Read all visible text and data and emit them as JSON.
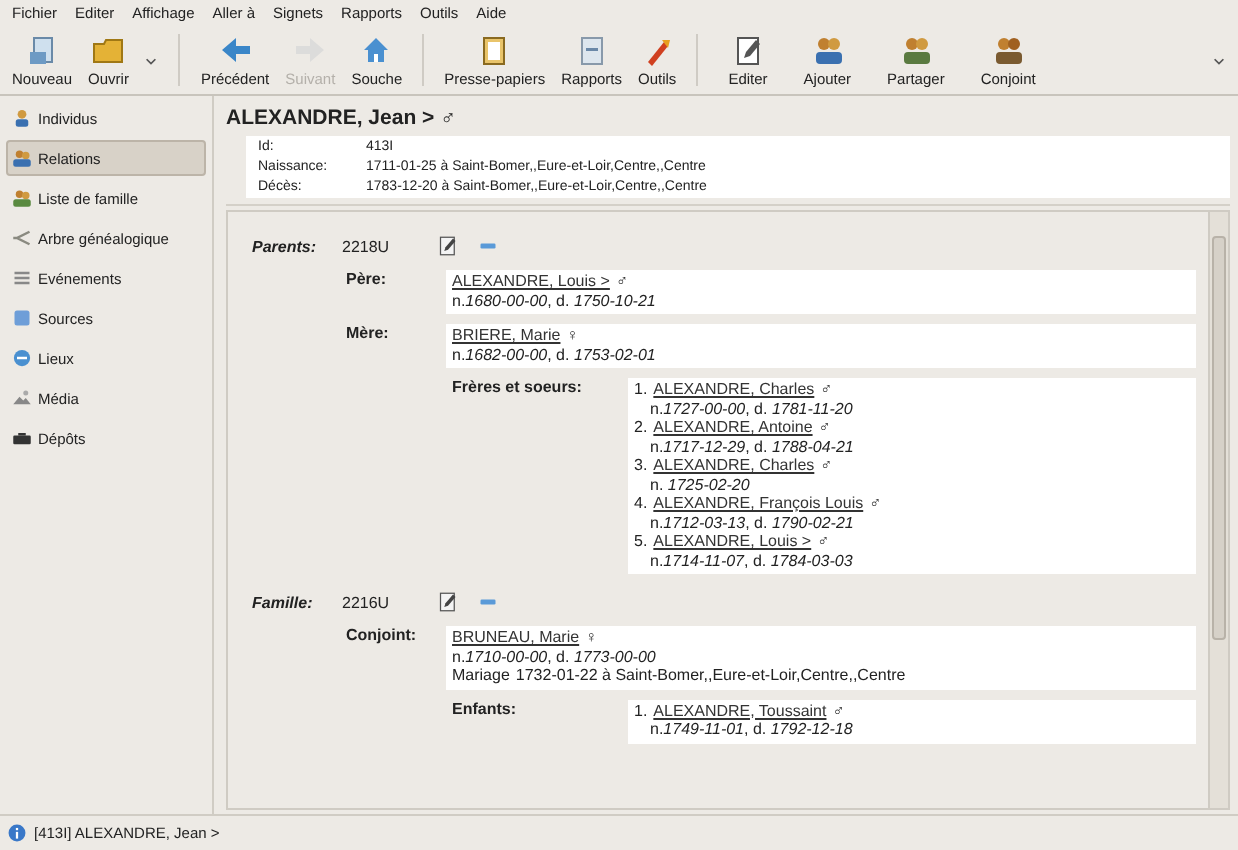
{
  "menu": [
    "Fichier",
    "Editer",
    "Affichage",
    "Aller à",
    "Signets",
    "Rapports",
    "Outils",
    "Aide"
  ],
  "toolbar": {
    "items": [
      {
        "kind": "button",
        "label": "Nouveau",
        "disabled": false
      },
      {
        "kind": "button",
        "label": "Ouvrir",
        "disabled": false
      },
      {
        "kind": "dropdown"
      },
      {
        "kind": "separator"
      },
      {
        "kind": "button",
        "label": "Précédent",
        "disabled": false
      },
      {
        "kind": "button",
        "label": "Suivant",
        "disabled": true
      },
      {
        "kind": "button",
        "label": "Souche",
        "disabled": false
      },
      {
        "kind": "separator"
      },
      {
        "kind": "button",
        "label": "Presse-papiers",
        "disabled": false
      },
      {
        "kind": "button",
        "label": "Rapports",
        "disabled": false
      },
      {
        "kind": "button",
        "label": "Outils",
        "disabled": false
      },
      {
        "kind": "separator"
      },
      {
        "kind": "button",
        "label": "Editer",
        "disabled": false
      },
      {
        "kind": "button",
        "label": "Ajouter",
        "disabled": false
      },
      {
        "kind": "button",
        "label": "Partager",
        "disabled": false
      },
      {
        "kind": "button",
        "label": "Conjoint",
        "disabled": false
      },
      {
        "kind": "dropdown"
      }
    ]
  },
  "sidebar": {
    "items": [
      {
        "label": "Individus",
        "selected": false
      },
      {
        "label": "Relations",
        "selected": true
      },
      {
        "label": "Liste de famille",
        "selected": false
      },
      {
        "label": "Arbre généalogique",
        "selected": false
      },
      {
        "label": "Evénements",
        "selected": false
      },
      {
        "label": "Sources",
        "selected": false
      },
      {
        "label": "Lieux",
        "selected": false
      },
      {
        "label": "Média",
        "selected": false
      },
      {
        "label": "Dépôts",
        "selected": false
      }
    ]
  },
  "person": {
    "name": "ALEXANDRE, Jean >",
    "sex": "♂",
    "facts": [
      {
        "label": "Id:",
        "value": "413I"
      },
      {
        "label": "Naissance:",
        "value": "1711-01-25 à Saint-Bomer,,Eure-et-Loir,Centre,,Centre"
      },
      {
        "label": "Décès:",
        "value": "1783-12-20 à Saint-Bomer,,Eure-et-Loir,Centre,,Centre"
      }
    ]
  },
  "families": [
    {
      "label": "Parents:",
      "id": "2218U",
      "members": [
        {
          "role": "Père:",
          "kind": "single",
          "people": [
            {
              "name": "ALEXANDRE, Louis >",
              "sex": "♂",
              "dates": "n.*1680-00-00*, d. *1750-10-21*"
            }
          ]
        },
        {
          "role": "Mère:",
          "kind": "single",
          "people": [
            {
              "name": "BRIERE, Marie",
              "sex": "♀",
              "dates": "n.*1682-00-00*, d. *1753-02-01*"
            }
          ]
        },
        {
          "role": "Frères et soeurs:",
          "kind": "list",
          "people": [
            {
              "number": "1.",
              "name": "ALEXANDRE, Charles",
              "sex": "♂",
              "dates": "n.*1727-00-00*, d. *1781-11-20*"
            },
            {
              "number": "2.",
              "name": "ALEXANDRE, Antoine",
              "sex": "♂",
              "dates": "n.*1717-12-29*, d. *1788-04-21*"
            },
            {
              "number": "3.",
              "name": "ALEXANDRE, Charles",
              "sex": "♂",
              "dates": "n. *1725-02-20*"
            },
            {
              "number": "4.",
              "name": "ALEXANDRE, François Louis",
              "sex": "♂",
              "dates": "n.*1712-03-13*, d. *1790-02-21*"
            },
            {
              "number": "5.",
              "name": "ALEXANDRE, Louis >",
              "sex": "♂",
              "dates": "n.*1714-11-07*, d. *1784-03-03*"
            }
          ]
        }
      ]
    },
    {
      "label": "Famille:",
      "id": "2216U",
      "members": [
        {
          "role": "Conjoint:",
          "kind": "single",
          "people": [
            {
              "name": "BRUNEAU, Marie",
              "sex": "♀",
              "dates": "n.*1710-00-00*, d. *1773-00-00*",
              "event": {
                "label": "Mariage",
                "value": "1732-01-22 à Saint-Bomer,,Eure-et-Loir,Centre,,Centre"
              }
            }
          ]
        },
        {
          "role": "Enfants:",
          "kind": "list",
          "people": [
            {
              "number": "1.",
              "name": "ALEXANDRE, Toussaint",
              "sex": "♂",
              "dates": "n.*1749-11-01*, d. *1792-12-18*"
            }
          ]
        }
      ]
    }
  ],
  "status_bar": {
    "text": "[413I] ALEXANDRE, Jean >"
  }
}
